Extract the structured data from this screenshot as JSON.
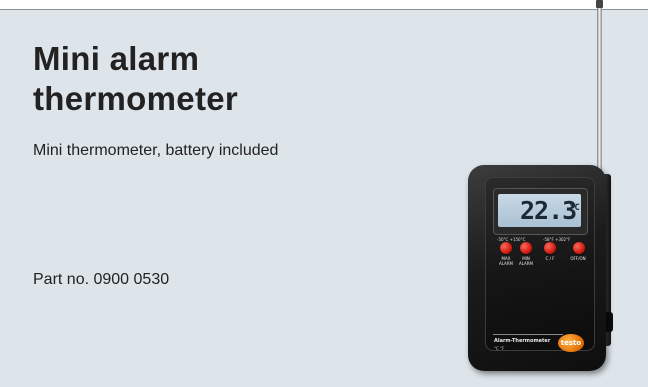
{
  "product": {
    "title": "Mini alarm\nthermometer",
    "description": "Mini thermometer, battery included",
    "part_number": "Part no. 0900 0530"
  },
  "device": {
    "display_value": "22.3",
    "display_unit": "°C",
    "range_celsius": "-50°C  +150°C",
    "range_fahrenheit": "-58°F  +302°F",
    "buttons": [
      {
        "label": "MAX\nALARM"
      },
      {
        "label": "MIN\nALARM"
      },
      {
        "label": "C / F"
      },
      {
        "label": "OFF/ON"
      }
    ],
    "model_label": "Alarm-Thermometer",
    "units_label": "°C  °F",
    "brand_logo": "testo"
  },
  "colors": {
    "card_background": "#dde4ea",
    "button_red": "#d01c10",
    "lcd": "#b8ccdc",
    "logo_orange": "#e06a00"
  }
}
